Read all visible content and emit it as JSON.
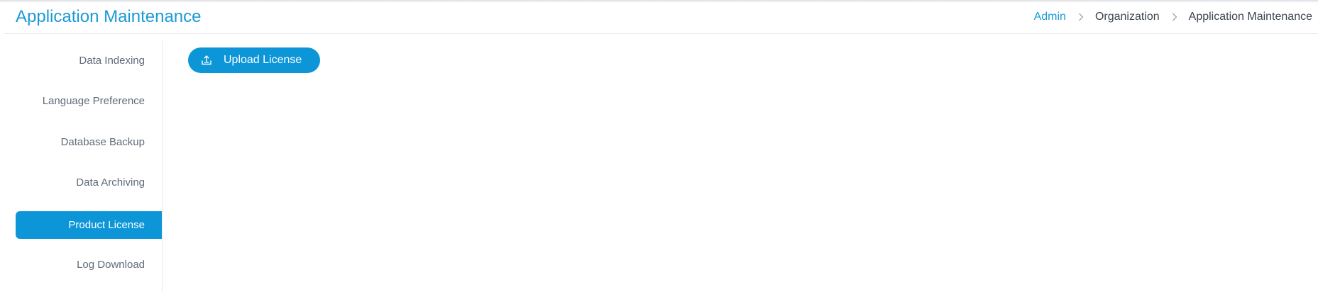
{
  "header": {
    "title": "Application Maintenance",
    "breadcrumb": {
      "admin": "Admin",
      "organization": "Organization",
      "current": "Application Maintenance",
      "separator": ">"
    }
  },
  "sidebar": {
    "items": [
      {
        "label": "Data Indexing",
        "active": false
      },
      {
        "label": "Language Preference",
        "active": false
      },
      {
        "label": "Database Backup",
        "active": false
      },
      {
        "label": "Data Archiving",
        "active": false
      },
      {
        "label": "Product License",
        "active": true
      },
      {
        "label": "Log Download",
        "active": false
      }
    ]
  },
  "main": {
    "upload_button_label": "Upload License",
    "upload_icon": "upload-icon"
  },
  "colors": {
    "accent": "#0c96d8",
    "title": "#1a9ad6",
    "sidebar_text": "#5f6b7a",
    "breadcrumb_text": "#3d4550"
  }
}
